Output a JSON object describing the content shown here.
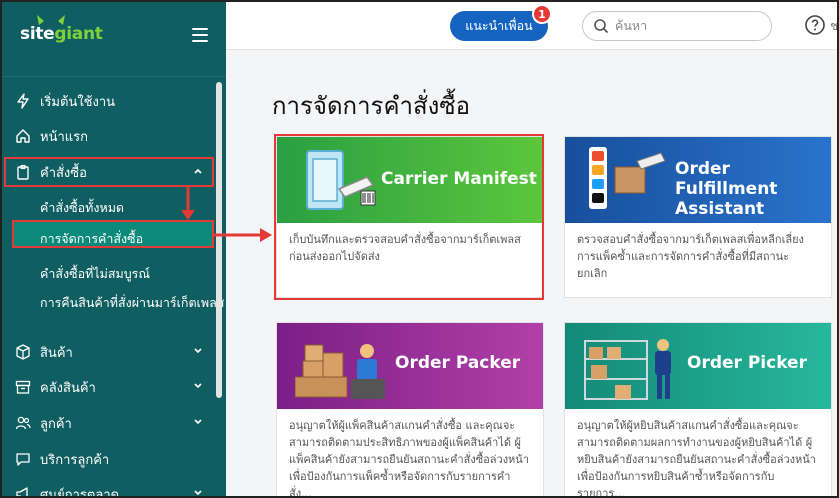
{
  "brand": {
    "logo_text_a": "site",
    "logo_text_b": "giant"
  },
  "topbar": {
    "refer_label": "แนะนำเพื่อน",
    "refer_badge": "1",
    "search_placeholder": "ค้นหา",
    "help_text": "ช"
  },
  "sidebar": {
    "items": [
      {
        "label": "เริ่มต้นใช้งาน",
        "icon": "bolt-icon"
      },
      {
        "label": "หน้าแรก",
        "icon": "home-icon"
      },
      {
        "label": "คำสั่งซื้อ",
        "icon": "clipboard-icon"
      },
      {
        "label": "สินค้า",
        "icon": "box-icon"
      },
      {
        "label": "คลังสินค้า",
        "icon": "archive-icon"
      },
      {
        "label": "ลูกค้า",
        "icon": "users-icon"
      },
      {
        "label": "บริการลูกค้า",
        "icon": "chat-icon"
      },
      {
        "label": "ศูนย์การตลาด",
        "icon": "megaphone-icon"
      }
    ],
    "orders_sub": [
      "คำสั่งซื้อทั้งหมด",
      "การจัดการคำสั่งซื้อ",
      "คำสั่งซื้อที่ไม่สมบูรณ์",
      "การคืนสินค้าที่สั่งผ่านมาร์เก็ตเพลส"
    ]
  },
  "main": {
    "title": "การจัดการคำสั่งซื้อ",
    "cards": [
      {
        "title": "Carrier Manifest",
        "desc": "เก็บบันทึกและตรวจสอบคำสั่งซื้อจากมาร์เก็ตเพลส ก่อนส่งออกไปจัดส่ง",
        "color": "#2db34a"
      },
      {
        "title": "Order Fulfillment Assistant",
        "desc": "ตรวจสอบคำสั่งซื้อจากมาร์เก็ตเพลสเพื่อหลีกเลี่ยง การแพ็คซ้ำและการจัดการคำสั่งซื้อที่มีสถานะยกเลิก",
        "color": "#1e63b8"
      },
      {
        "title": "Order Packer",
        "desc": "อนุญาตให้ผู้แพ็คสินค้าสแกนคำสั่งซื้อ และคุณจะสามารถติดตามประสิทธิภาพของผู้แพ็คสินค้าได้ ผู้แพ็คสินค้ายังสามารถยืนยันสถานะคำสั่งซื้อล่วงหน้า เพื่อป้องกันการแพ็คซ้ำหรือจัดการกับรายการคำสั่ง...",
        "color": "#8e2a8e"
      },
      {
        "title": "Order Picker",
        "desc": "อนุญาตให้ผู้หยิบสินค้าสแกนคำสั่งซื้อและคุณจะสามารถติดตามผลการทำงานของผู้หยิบสินค้าได้ ผู้หยิบสินค้ายังสามารถยืนยันสถานะคำสั่งซื้อล่วงหน้า เพื่อป้องกันการหยิบสินค้าซ้ำหรือจัดการกับรายการ...",
        "color": "#1aa38a"
      }
    ]
  }
}
